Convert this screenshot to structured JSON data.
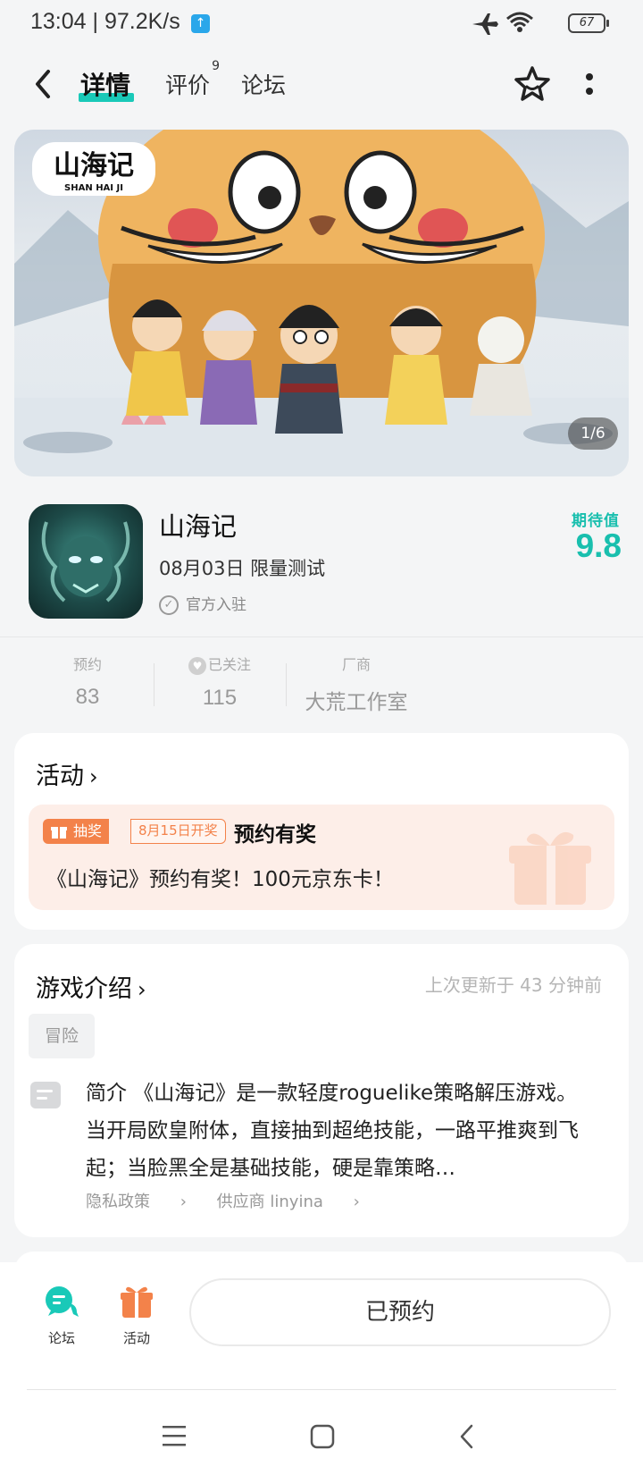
{
  "status": {
    "time": "13:04 | 97.2K/s",
    "battery": "67"
  },
  "nav": {
    "tabs": [
      {
        "label": "详情"
      },
      {
        "label": "评价",
        "badge": "9"
      },
      {
        "label": "论坛"
      }
    ]
  },
  "banner": {
    "logo_text": "山海记",
    "logo_sub": "SHAN HAI JI",
    "counter": "1/6"
  },
  "app": {
    "name": "山海记",
    "date": "08月03日 限量测试",
    "official": "官方入驻",
    "expect_label": "期待值",
    "expect_value": "9.8"
  },
  "stats": [
    {
      "label": "预约",
      "value": "83"
    },
    {
      "label": "已关注",
      "value": "115"
    },
    {
      "label": "厂商",
      "value": "大荒工作室"
    }
  ],
  "activity": {
    "title": "活动",
    "tag": "抽奖",
    "date_tag": "8月15日开奖",
    "promo_title": "预约有奖",
    "promo_text": "《山海记》预约有奖！100元京东卡！"
  },
  "intro": {
    "title": "游戏介绍",
    "updated": "上次更新于 43 分钟前",
    "genre": "冒险",
    "text": "简介 《山海记》是一款轻度roguelike策略解压游戏。当开局欧皇附体，直接抽到超绝技能，一路平推爽到飞起；当脸黑全是基础技能，硬是靠策略…",
    "privacy": "隐私政策",
    "provider": "供应商 linyina"
  },
  "bottom": {
    "forum": "论坛",
    "activity": "活动",
    "reserve": "已预约"
  },
  "colors": {
    "accent": "#19c9b8",
    "orange": "#f3824a"
  }
}
